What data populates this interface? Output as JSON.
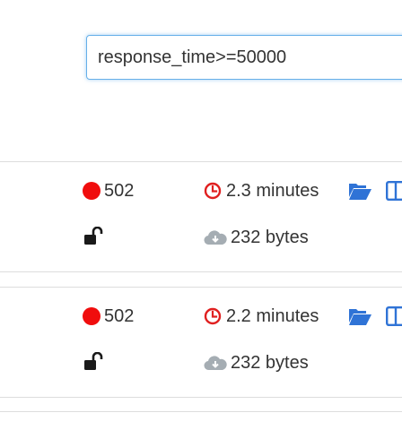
{
  "filter": {
    "value": "response_time>=50000"
  },
  "colors": {
    "status_error": "#f00d0d",
    "clock": "#e02020",
    "icon_blue": "#2f73d6",
    "cloud_gray": "#a5adb3",
    "lock_dark": "#1a1a1a",
    "border": "#dddddd"
  },
  "rows": [
    {
      "status_code": "502",
      "duration": "2.3 minutes",
      "size": "232 bytes",
      "icons": [
        "status-dot-icon",
        "clock-icon",
        "unlock-icon",
        "cloud-download-icon",
        "folder-open-icon",
        "columns-icon"
      ]
    },
    {
      "status_code": "502",
      "duration": "2.2 minutes",
      "size": "232 bytes",
      "icons": [
        "status-dot-icon",
        "clock-icon",
        "unlock-icon",
        "cloud-download-icon",
        "folder-open-icon",
        "columns-icon"
      ]
    }
  ]
}
